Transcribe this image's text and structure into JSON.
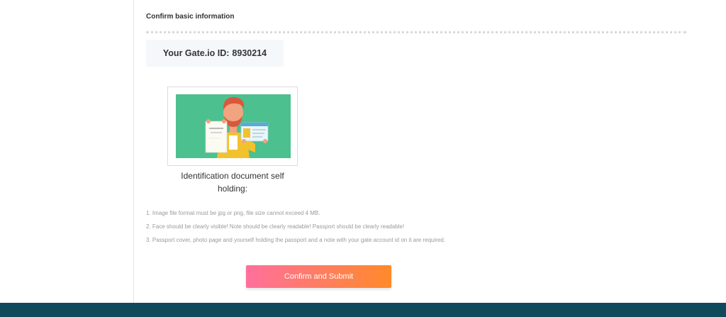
{
  "section": {
    "title": "Confirm basic information"
  },
  "account": {
    "id_label": "Your Gate.io ID:",
    "id_value": "8930214"
  },
  "upload": {
    "image_icon": "person-holding-id-illustration",
    "caption": "Identification document self holding:"
  },
  "notes": [
    "1. Image file format must be jpg or png, file size cannot exceed 4 MB.",
    "2. Face should be clearly visible! Note should be clearly readable! Passport should be clearly readable!",
    "3. Passport cover, photo page and yourself holding the passport and a note with your gate account id on it are required."
  ],
  "actions": {
    "submit_label": "Confirm and Submit"
  },
  "colors": {
    "footer": "#0e4a5c",
    "button_start": "#ff6f9c",
    "button_end": "#ff8a2a",
    "illustration_bg": "#4cc08e"
  }
}
